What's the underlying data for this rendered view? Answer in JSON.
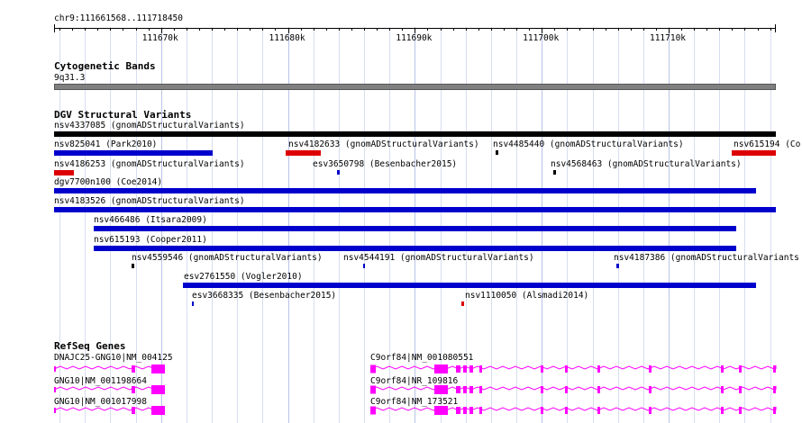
{
  "ruler": {
    "position_label": "chr9:111661568..111718450",
    "start": 111661568,
    "end": 111718450,
    "ticks": [
      {
        "value": 111670000,
        "label": "111670k"
      },
      {
        "value": 111680000,
        "label": "111680k"
      },
      {
        "value": 111690000,
        "label": "111690k"
      },
      {
        "value": 111700000,
        "label": "111700k"
      },
      {
        "value": 111710000,
        "label": "111710k"
      }
    ]
  },
  "cytobands": {
    "title": "Cytogenetic Bands",
    "band": "9q31.3",
    "color": "#808080"
  },
  "dgv": {
    "title": "DGV Structural Variants",
    "colors": {
      "black": "#000000",
      "blue": "#0000cc",
      "red": "#dd0000"
    },
    "features": [
      {
        "label": "nsv4337085 (gnomADStructuralVariants)",
        "start": 111661568,
        "end": 111718450,
        "color": "black"
      },
      {
        "label": "nsv825041 (Park2010)",
        "start": 111661568,
        "end": 111674100,
        "color": "blue"
      },
      {
        "label": "nsv4182633 (gnomADStructuralVariants)",
        "start": 111679800,
        "end": 111682600,
        "color": "red"
      },
      {
        "label": "nsv4485440 (gnomADStructuralVariants)",
        "start": 111696400,
        "end": 111696600,
        "color": "black"
      },
      {
        "label": "nsv615194 (Co",
        "start": 111715000,
        "end": 111718450,
        "color": "red"
      },
      {
        "label": "nsv4186253 (gnomADStructuralVariants)",
        "start": 111661568,
        "end": 111663100,
        "color": "red"
      },
      {
        "label": "esv3650798 (Besenbacher2015)",
        "start": 111683900,
        "end": 111684100,
        "color": "blue"
      },
      {
        "label": "nsv4568463 (gnomADStructuralVariants)",
        "start": 111700900,
        "end": 111701100,
        "color": "black"
      },
      {
        "label": "dgv7700n100 (Coe2014)",
        "start": 111661568,
        "end": 111716900,
        "color": "blue"
      },
      {
        "label": "nsv4183526 (gnomADStructuralVariants)",
        "start": 111661568,
        "end": 111718450,
        "color": "blue"
      },
      {
        "label": "nsv466486 (Itsara2009)",
        "start": 111664700,
        "end": 111715300,
        "color": "blue"
      },
      {
        "label": "nsv615193 (Cooper2011)",
        "start": 111664700,
        "end": 111715300,
        "color": "blue"
      },
      {
        "label": "nsv4559546 (gnomADStructuralVariants)",
        "start": 111667700,
        "end": 111667900,
        "color": "black"
      },
      {
        "label": "nsv4544191 (gnomADStructuralVariants)",
        "start": 111685900,
        "end": 111686100,
        "color": "blue"
      },
      {
        "label": "nsv4187386 (gnomADStructuralVariants",
        "start": 111705900,
        "end": 111706100,
        "color": "blue"
      },
      {
        "label": "esv2761550 (Vogler2010)",
        "start": 111671700,
        "end": 111716900,
        "color": "blue"
      },
      {
        "label": "esv3668335 (Besenbacher2015)",
        "start": 111672400,
        "end": 111672600,
        "color": "blue"
      },
      {
        "label": "nsv1110050 (Alsmadi2014)",
        "start": 111693700,
        "end": 111693900,
        "color": "red"
      }
    ]
  },
  "refseq": {
    "title": "RefSeq Genes",
    "color": "#ff00ff",
    "left_genes": [
      {
        "label": "DNAJC25-GNG10|NM_004125"
      },
      {
        "label": "GNG10|NM_001198664"
      },
      {
        "label": "GNG10|NM_001017998"
      }
    ],
    "right_genes": [
      {
        "label": "C9orf84|NM_001080551"
      },
      {
        "label": "C9orf84|NR_109816"
      },
      {
        "label": "C9orf84|NM_173521"
      }
    ]
  }
}
